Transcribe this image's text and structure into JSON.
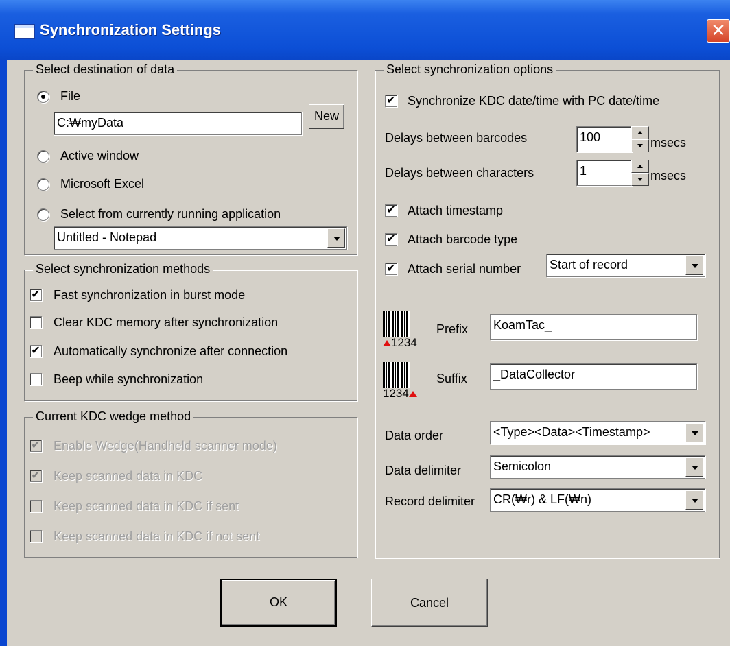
{
  "window": {
    "title": "Synchronization Settings",
    "close_glyph": "✕"
  },
  "destination": {
    "legend": "Select destination of data",
    "options": [
      {
        "label": "File",
        "selected": true
      },
      {
        "label": "Active window",
        "selected": false
      },
      {
        "label": "Microsoft Excel",
        "selected": false
      },
      {
        "label": "Select from currently running application",
        "selected": false
      }
    ],
    "file_path": "C:₩myData",
    "new_label": "New",
    "app_selected": "Untitled - Notepad"
  },
  "methods": {
    "legend": "Select synchronization methods",
    "items": [
      {
        "label": "Fast synchronization in burst mode",
        "checked": true
      },
      {
        "label": "Clear KDC memory after synchronization",
        "checked": false
      },
      {
        "label": "Automatically synchronize after connection",
        "checked": true
      },
      {
        "label": "Beep while synchronization",
        "checked": false
      }
    ]
  },
  "wedge": {
    "legend": "Current KDC wedge method",
    "items": [
      {
        "label": "Enable Wedge(Handheld scanner mode)",
        "checked": true
      },
      {
        "label": "Keep scanned data in KDC",
        "checked": true
      },
      {
        "label": "Keep scanned data in KDC if sent",
        "checked": false
      },
      {
        "label": "Keep scanned data in KDC if not sent",
        "checked": false
      }
    ]
  },
  "options": {
    "legend": "Select synchronization options",
    "sync_datetime": {
      "label": "Synchronize KDC date/time with PC date/time",
      "checked": true
    },
    "delay_barcodes": {
      "label": "Delays between barcodes",
      "value": "100",
      "unit": "msecs"
    },
    "delay_chars": {
      "label": "Delays between characters",
      "value": "1",
      "unit": "msecs"
    },
    "attach_timestamp": {
      "label": "Attach timestamp",
      "checked": true
    },
    "attach_barcode_type": {
      "label": "Attach barcode type",
      "checked": true
    },
    "attach_serial": {
      "label": "Attach serial number",
      "checked": true,
      "position": "Start of record"
    },
    "prefix": {
      "label": "Prefix",
      "value": "KoamTac_",
      "icon_digits": "1234"
    },
    "suffix": {
      "label": "Suffix",
      "value": "_DataCollector",
      "icon_digits": "1234"
    },
    "data_order": {
      "label": "Data order",
      "value": "<Type><Data><Timestamp>"
    },
    "data_delimiter": {
      "label": "Data delimiter",
      "value": "Semicolon"
    },
    "record_delimiter": {
      "label": "Record delimiter",
      "value": "CR(₩r) & LF(₩n)"
    }
  },
  "buttons": {
    "ok": "OK",
    "cancel": "Cancel"
  }
}
